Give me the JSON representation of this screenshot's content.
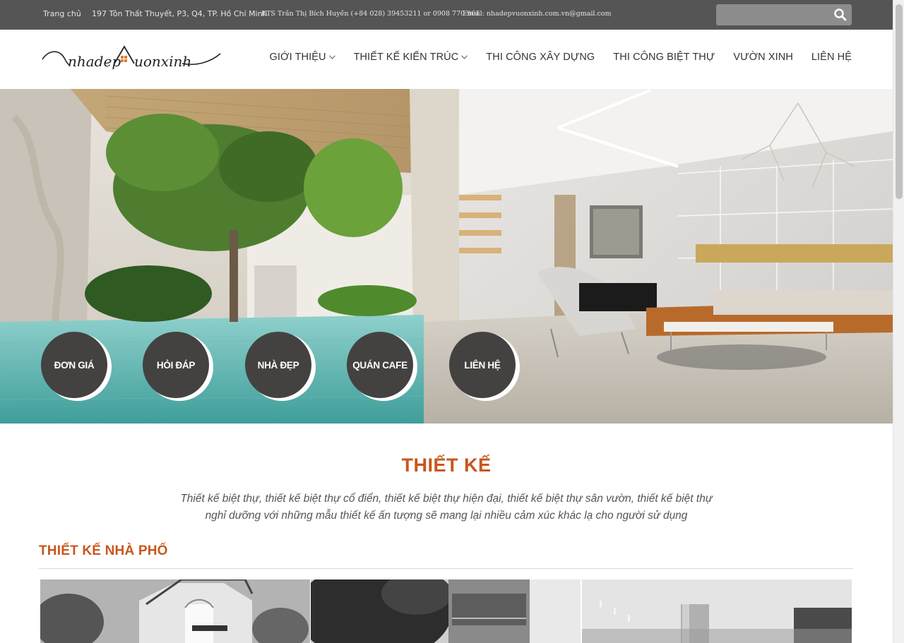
{
  "topbar": {
    "home_link": "Trang chủ",
    "address": "197 Tôn Thất Thuyết, P3, Q4, TP. Hồ Chí Minh",
    "architect_contact": "KTS Trần Thị Bích Huyền (+84 028) 39453211 or 0908 770 961",
    "email": "Email: nhadepvuonxinh.com.vn@gmail.com",
    "search_placeholder": ""
  },
  "logo": {
    "text": "nhadepvuonxinh",
    "accent_color": "#e07b2c"
  },
  "nav": {
    "items": [
      {
        "label": "GIỚI THIỆU",
        "has_dropdown": true
      },
      {
        "label": "THIẾT KẾ KIẾN TRÚC",
        "has_dropdown": true
      },
      {
        "label": "THI CÔNG XÂY DỰNG",
        "has_dropdown": false
      },
      {
        "label": "THI CÔNG BIỆT THỰ",
        "has_dropdown": false
      },
      {
        "label": "VƯỜN XINH",
        "has_dropdown": false
      },
      {
        "label": "LIÊN HỆ",
        "has_dropdown": false
      }
    ]
  },
  "hero": {
    "buttons": [
      {
        "label": "ĐƠN GIÁ"
      },
      {
        "label": "HỎI ĐÁP"
      },
      {
        "label": "NHÀ ĐẸP"
      },
      {
        "label": "QUÁN CAFE"
      },
      {
        "label": "LIÊN HỆ"
      }
    ]
  },
  "section": {
    "title": "THIẾT KẾ",
    "description_line1": "Thiết kế biệt thự, thiết kế biệt thự cổ điển, thiết kế biệt thự hiện đại, thiết kế biệt thự sân vườn, thiết kế biệt thự",
    "description_line2": "nghỉ dưỡng với những mẫu thiết kế ấn tượng sẽ mang lại nhiều cảm xúc khác lạ cho người sử dụng",
    "subsection_title": "THIẾT KẾ NHÀ PHỐ"
  },
  "colors": {
    "accent": "#c8561c",
    "topbar_bg": "#555555",
    "circle_bg": "#444240"
  },
  "icons": {
    "search": "search-icon",
    "dropdown": "chevron-down-icon"
  }
}
